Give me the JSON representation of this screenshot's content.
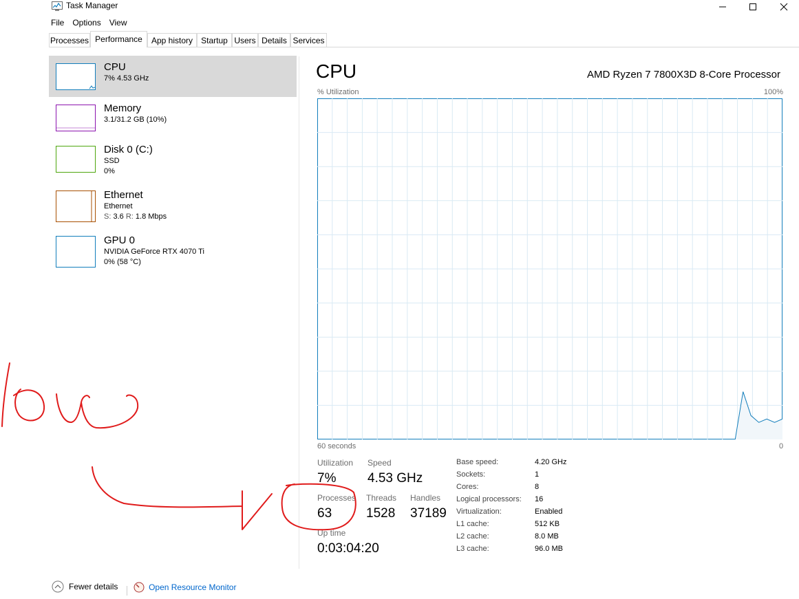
{
  "window": {
    "title": "Task Manager"
  },
  "menu": [
    "File",
    "Options",
    "View"
  ],
  "tabs": [
    "Processes",
    "Performance",
    "App history",
    "Startup",
    "Users",
    "Details",
    "Services"
  ],
  "sidebar": {
    "items": [
      {
        "name": "CPU",
        "lines": [
          "7%  4.53 GHz"
        ],
        "color": "#117dbb"
      },
      {
        "name": "Memory",
        "lines": [
          "3.1/31.2 GB (10%)"
        ],
        "color": "#8b12ae"
      },
      {
        "name": "Disk 0 (C:)",
        "lines": [
          "SSD",
          "0%"
        ],
        "color": "#4da60c"
      },
      {
        "name": "Ethernet",
        "lines": [
          "Ethernet"
        ],
        "s_label": "S:",
        "s_value": "3.6",
        "r_label": "R:",
        "r_value": "1.8 Mbps",
        "color": "#a74f01"
      },
      {
        "name": "GPU 0",
        "lines": [
          "NVIDIA GeForce RTX 4070 Ti",
          "0%  (58 °C)"
        ],
        "color": "#117dbb"
      }
    ]
  },
  "main": {
    "title": "CPU",
    "processor": "AMD Ryzen 7 7800X3D 8-Core Processor",
    "graph_label": "% Utilization",
    "graph_max": "100%",
    "graph_time": "60 seconds",
    "graph_min": "0",
    "chart_data": {
      "type": "area",
      "ylim": [
        0,
        100
      ],
      "series": [
        {
          "values": [
            0,
            0,
            0,
            0,
            0,
            0,
            0,
            0,
            0,
            0,
            0,
            0,
            0,
            0,
            0,
            0,
            0,
            0,
            0,
            0,
            0,
            0,
            0,
            0,
            0,
            0,
            0,
            0,
            0,
            0,
            0,
            0,
            0,
            0,
            0,
            0,
            0,
            0,
            0,
            0,
            0,
            0,
            0,
            0,
            0,
            0,
            0,
            0,
            0,
            0,
            0,
            0,
            0,
            0,
            14,
            7,
            5,
            6,
            5,
            6
          ]
        }
      ]
    },
    "stats": {
      "utilization_label": "Utilization",
      "utilization": "7%",
      "speed_label": "Speed",
      "speed": "4.53 GHz",
      "processes_label": "Processes",
      "processes": "63",
      "threads_label": "Threads",
      "threads": "1528",
      "handles_label": "Handles",
      "handles": "37189",
      "uptime_label": "Up time",
      "uptime": "0:03:04:20"
    },
    "specs": [
      {
        "label": "Base speed:",
        "value": "4.20 GHz"
      },
      {
        "label": "Sockets:",
        "value": "1"
      },
      {
        "label": "Cores:",
        "value": "8"
      },
      {
        "label": "Logical processors:",
        "value": "16"
      },
      {
        "label": "Virtualization:",
        "value": "Enabled"
      },
      {
        "label": "L1 cache:",
        "value": "512 KB"
      },
      {
        "label": "L2 cache:",
        "value": "8.0 MB"
      },
      {
        "label": "L3 cache:",
        "value": "96.0 MB"
      }
    ]
  },
  "footer": {
    "fewer_details": "Fewer details",
    "resource_monitor": "Open Resource Monitor"
  },
  "annotation": {
    "handwriting": "low"
  }
}
